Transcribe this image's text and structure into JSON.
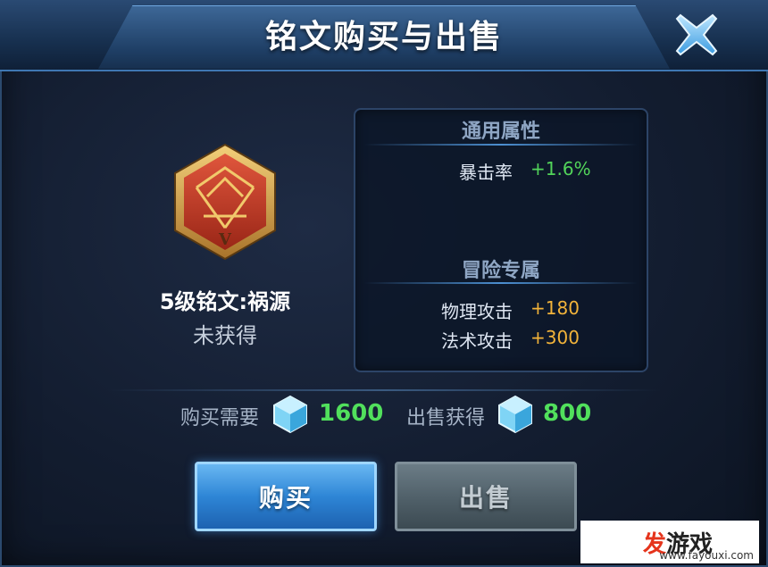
{
  "window": {
    "title": "铭文购买与出售",
    "close_icon": "close-x-icon"
  },
  "item": {
    "icon": "inscription-emblem-icon",
    "emblem_level_numeral": "V",
    "name": "5级铭文:祸源",
    "status": "未获得"
  },
  "attributes": {
    "general": {
      "title": "通用属性",
      "rows": [
        {
          "label": "暴击率",
          "value": "+1.6%"
        }
      ]
    },
    "adventure": {
      "title": "冒险专属",
      "rows": [
        {
          "label": "物理攻击",
          "value": "+180"
        },
        {
          "label": "法术攻击",
          "value": "+300"
        }
      ]
    }
  },
  "colors": {
    "general_value": "#52d45a",
    "adventure_value": "#f2b33a",
    "price_value": "#51e05c"
  },
  "trade": {
    "buy_cost_label": "购买需要",
    "buy_cost_value": "1600",
    "sell_gain_label": "出售获得",
    "sell_gain_value": "800",
    "currency_icon": "crystal-gem-icon"
  },
  "buttons": {
    "buy_label": "购买",
    "sell_label": "出售"
  },
  "watermark": {
    "brand_char": "发",
    "rest": "游戏",
    "url": "www.fayouxi.com"
  }
}
